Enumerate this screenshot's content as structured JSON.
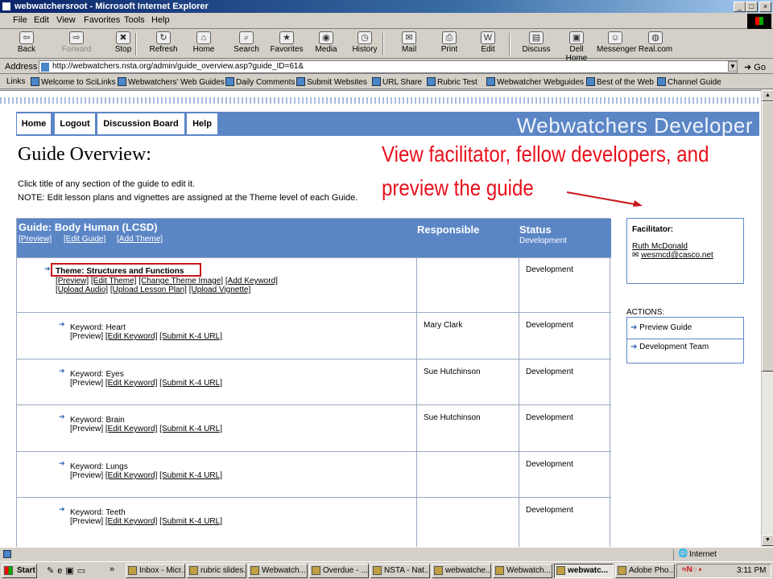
{
  "window": {
    "title": "webwatchersroot - Microsoft Internet Explorer",
    "min": "_",
    "max": "□",
    "close": "×"
  },
  "menu": [
    "File",
    "Edit",
    "View",
    "Favorites",
    "Tools",
    "Help"
  ],
  "toolbar": [
    {
      "label": "Back",
      "icon": "back-arrow-icon",
      "glyph": "⇦"
    },
    {
      "label": "Forward",
      "icon": "forward-arrow-icon",
      "glyph": "⇨",
      "disabled": true
    },
    {
      "label": "Stop",
      "icon": "stop-icon",
      "glyph": "✖"
    },
    {
      "label": "Refresh",
      "icon": "refresh-icon",
      "glyph": "↻"
    },
    {
      "label": "Home",
      "icon": "home-icon",
      "glyph": "⌂"
    },
    {
      "label": "Search",
      "icon": "search-icon",
      "glyph": "⌕"
    },
    {
      "label": "Favorites",
      "icon": "favorites-icon",
      "glyph": "★"
    },
    {
      "label": "Media",
      "icon": "media-icon",
      "glyph": "◉"
    },
    {
      "label": "History",
      "icon": "history-icon",
      "glyph": "◷"
    },
    {
      "label": "Mail",
      "icon": "mail-icon",
      "glyph": "✉"
    },
    {
      "label": "Print",
      "icon": "print-icon",
      "glyph": "⎙"
    },
    {
      "label": "Edit",
      "icon": "edit-icon",
      "glyph": "W"
    },
    {
      "label": "Discuss",
      "icon": "discuss-icon",
      "glyph": "▤"
    },
    {
      "label": "Dell Home",
      "icon": "dell-home-icon",
      "glyph": "▣"
    },
    {
      "label": "Messenger",
      "icon": "messenger-icon",
      "glyph": "☺"
    },
    {
      "label": "Real.com",
      "icon": "real-icon",
      "glyph": "◍"
    }
  ],
  "address": {
    "label": "Address",
    "url": "http://webwatchers.nsta.org/admin/guide_overview.asp?guide_ID=61&",
    "go": "Go"
  },
  "links": {
    "label": "Links",
    "items": [
      "Welcome to SciLinks",
      "Webwatchers' Web Guides",
      "Daily Comments",
      "Submit Websites",
      "URL Share",
      "Rubric Test",
      "Webwatcher Webguides",
      "Best of the Web",
      "Channel Guide"
    ]
  },
  "nav": {
    "tabs": [
      "Home",
      "Logout",
      "Discussion Board",
      "Help"
    ],
    "brand": "Webwatchers Developer"
  },
  "page": {
    "title": "Guide Overview:",
    "note1": "Click title of any section of the guide to edit it.",
    "note2": "NOTE: Edit lesson plans and vignettes are assigned at the Theme level of each Guide.",
    "annotation_line1": "View facilitator, fellow developers, and",
    "annotation_line2": "preview the guide"
  },
  "guide": {
    "title": "Guide: Body Human (LCSD)",
    "links": [
      "[Preview]",
      "[Edit Guide]",
      "[Add Theme]"
    ],
    "col_responsible": "Responsible",
    "col_status": "Status",
    "status_sub": "Development",
    "theme": {
      "title": "Theme: Structures and Functions",
      "line2": [
        "[Preview]",
        "[Edit Theme]",
        "[Change Theme Image]",
        "[Add Keyword]"
      ],
      "line3": [
        "[Upload Audio]",
        "[Upload Lesson Plan]",
        "[Upload Vignette]"
      ],
      "status": "Development"
    },
    "keywords": [
      {
        "name": "Keyword: Heart",
        "responsible": "Mary Clark",
        "status": "Development"
      },
      {
        "name": "Keyword: Eyes",
        "responsible": "Sue Hutchinson",
        "status": "Development"
      },
      {
        "name": "Keyword: Brain",
        "responsible": "Sue Hutchinson",
        "status": "Development"
      },
      {
        "name": "Keyword: Lungs",
        "responsible": "",
        "status": "Development"
      },
      {
        "name": "Keyword: Teeth",
        "responsible": "",
        "status": "Development"
      }
    ],
    "kw_links": {
      "preview": "[Preview]",
      "edit": "[Edit Keyword]",
      "submit": "[Submit K-4 URL]"
    }
  },
  "facilitator": {
    "label": "Facilitator:",
    "name": "Ruth McDonald",
    "email": "wesmcd@casco.net"
  },
  "actions": {
    "label": "ACTIONS:",
    "items": [
      "Preview Guide",
      "Development Team"
    ]
  },
  "status": {
    "zone": "Internet"
  },
  "taskbar": {
    "start": "Start",
    "tasks": [
      "Inbox - Micr...",
      "rubric slides...",
      "Webwatch...",
      "Overdue - ...",
      "NSTA - Nat...",
      "webwatche...",
      "Webwatch...",
      "webwatc...",
      "Adobe Pho..."
    ],
    "active_index": 7,
    "clock": "3:11 PM"
  }
}
